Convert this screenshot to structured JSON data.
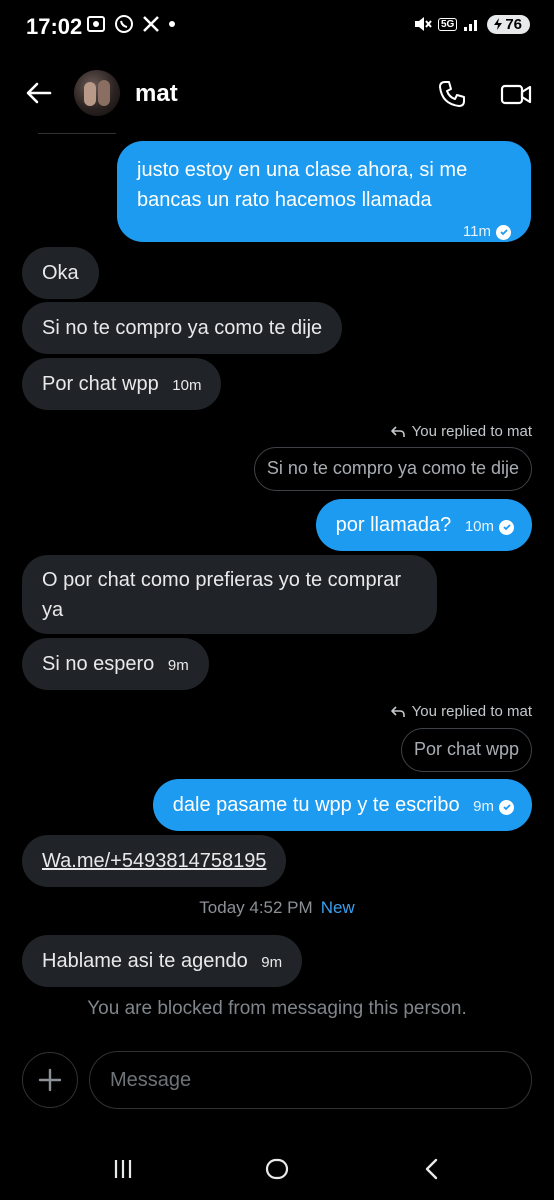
{
  "status_bar": {
    "time": "17:02",
    "battery": "76",
    "network": "5G"
  },
  "header": {
    "contact_name": "mat"
  },
  "messages": {
    "m1": {
      "text": "justo estoy en una clase ahora, si me bancas un rato hacemos llamada",
      "time": "11m"
    },
    "m2": {
      "text": "Oka"
    },
    "m3": {
      "text": "Si no te compro ya como te dije"
    },
    "m4": {
      "text": "Por chat wpp",
      "time": "10m"
    },
    "m5": {
      "reply_label": "You replied to mat",
      "quoted": "Si no te compro ya como te dije",
      "text": "por llamada?",
      "time": "10m"
    },
    "m6": {
      "text": "O por chat como prefieras yo te comprar ya"
    },
    "m7": {
      "text": "Si no espero",
      "time": "9m"
    },
    "m8": {
      "reply_label": "You replied to mat",
      "quoted": "Por chat wpp",
      "text": "dale pasame tu wpp y te escribo",
      "time": "9m"
    },
    "m9": {
      "link": "Wa.me/+5493814758195"
    },
    "separator": {
      "date": "Today 4:52 PM",
      "new_label": "New"
    },
    "m10": {
      "text": "Hablame asi te agendo",
      "time": "9m"
    }
  },
  "blocked_notice": "You are blocked from messaging this person.",
  "composer": {
    "placeholder": "Message"
  },
  "colors": {
    "background": "#000000",
    "sent_bubble": "#1d9bf0",
    "received_bubble": "#202327",
    "new_label": "#3aa0f0"
  },
  "icons": [
    "back-arrow-icon",
    "phone-icon",
    "video-camera-icon",
    "check-circle-icon",
    "reply-arrow-icon",
    "plus-icon",
    "recents-icon",
    "home-icon",
    "back-chevron-icon"
  ]
}
